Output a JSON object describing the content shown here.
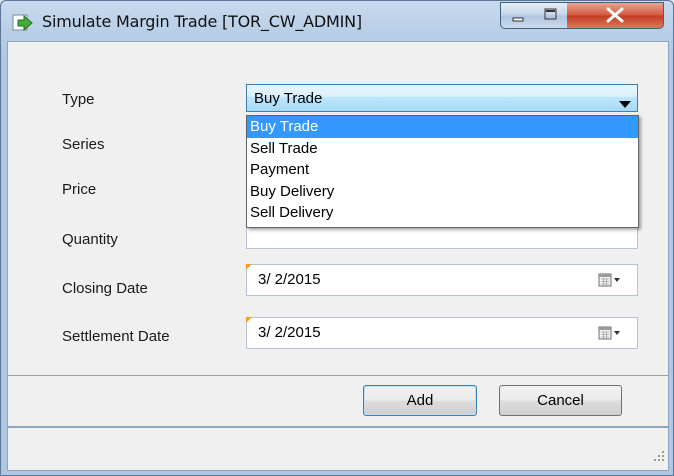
{
  "window": {
    "title": "Simulate Margin Trade [TOR_CW_ADMIN]"
  },
  "form": {
    "type_label": "Type",
    "type_value": "Buy Trade",
    "type_options": [
      "Buy Trade",
      "Sell Trade",
      "Payment",
      "Buy Delivery",
      "Sell Delivery"
    ],
    "series_label": "Series",
    "price_label": "Price",
    "quantity_label": "Quantity",
    "quantity_value": "",
    "closing_date_label": "Closing Date",
    "closing_date_value": "3/  2/2015",
    "settlement_date_label": "Settlement Date",
    "settlement_date_value": "3/  2/2015"
  },
  "buttons": {
    "add": "Add",
    "cancel": "Cancel"
  },
  "icons": {
    "app": "arrow-right-icon",
    "minimize": "minimize-icon",
    "maximize": "maximize-icon",
    "close": "close-icon",
    "dropdown": "chevron-down-icon",
    "calendar": "calendar-icon",
    "resize": "resize-grip-icon"
  },
  "colors": {
    "selection": "#3399ff",
    "close_button": "#c9472c",
    "required_marker": "#f5a020"
  }
}
